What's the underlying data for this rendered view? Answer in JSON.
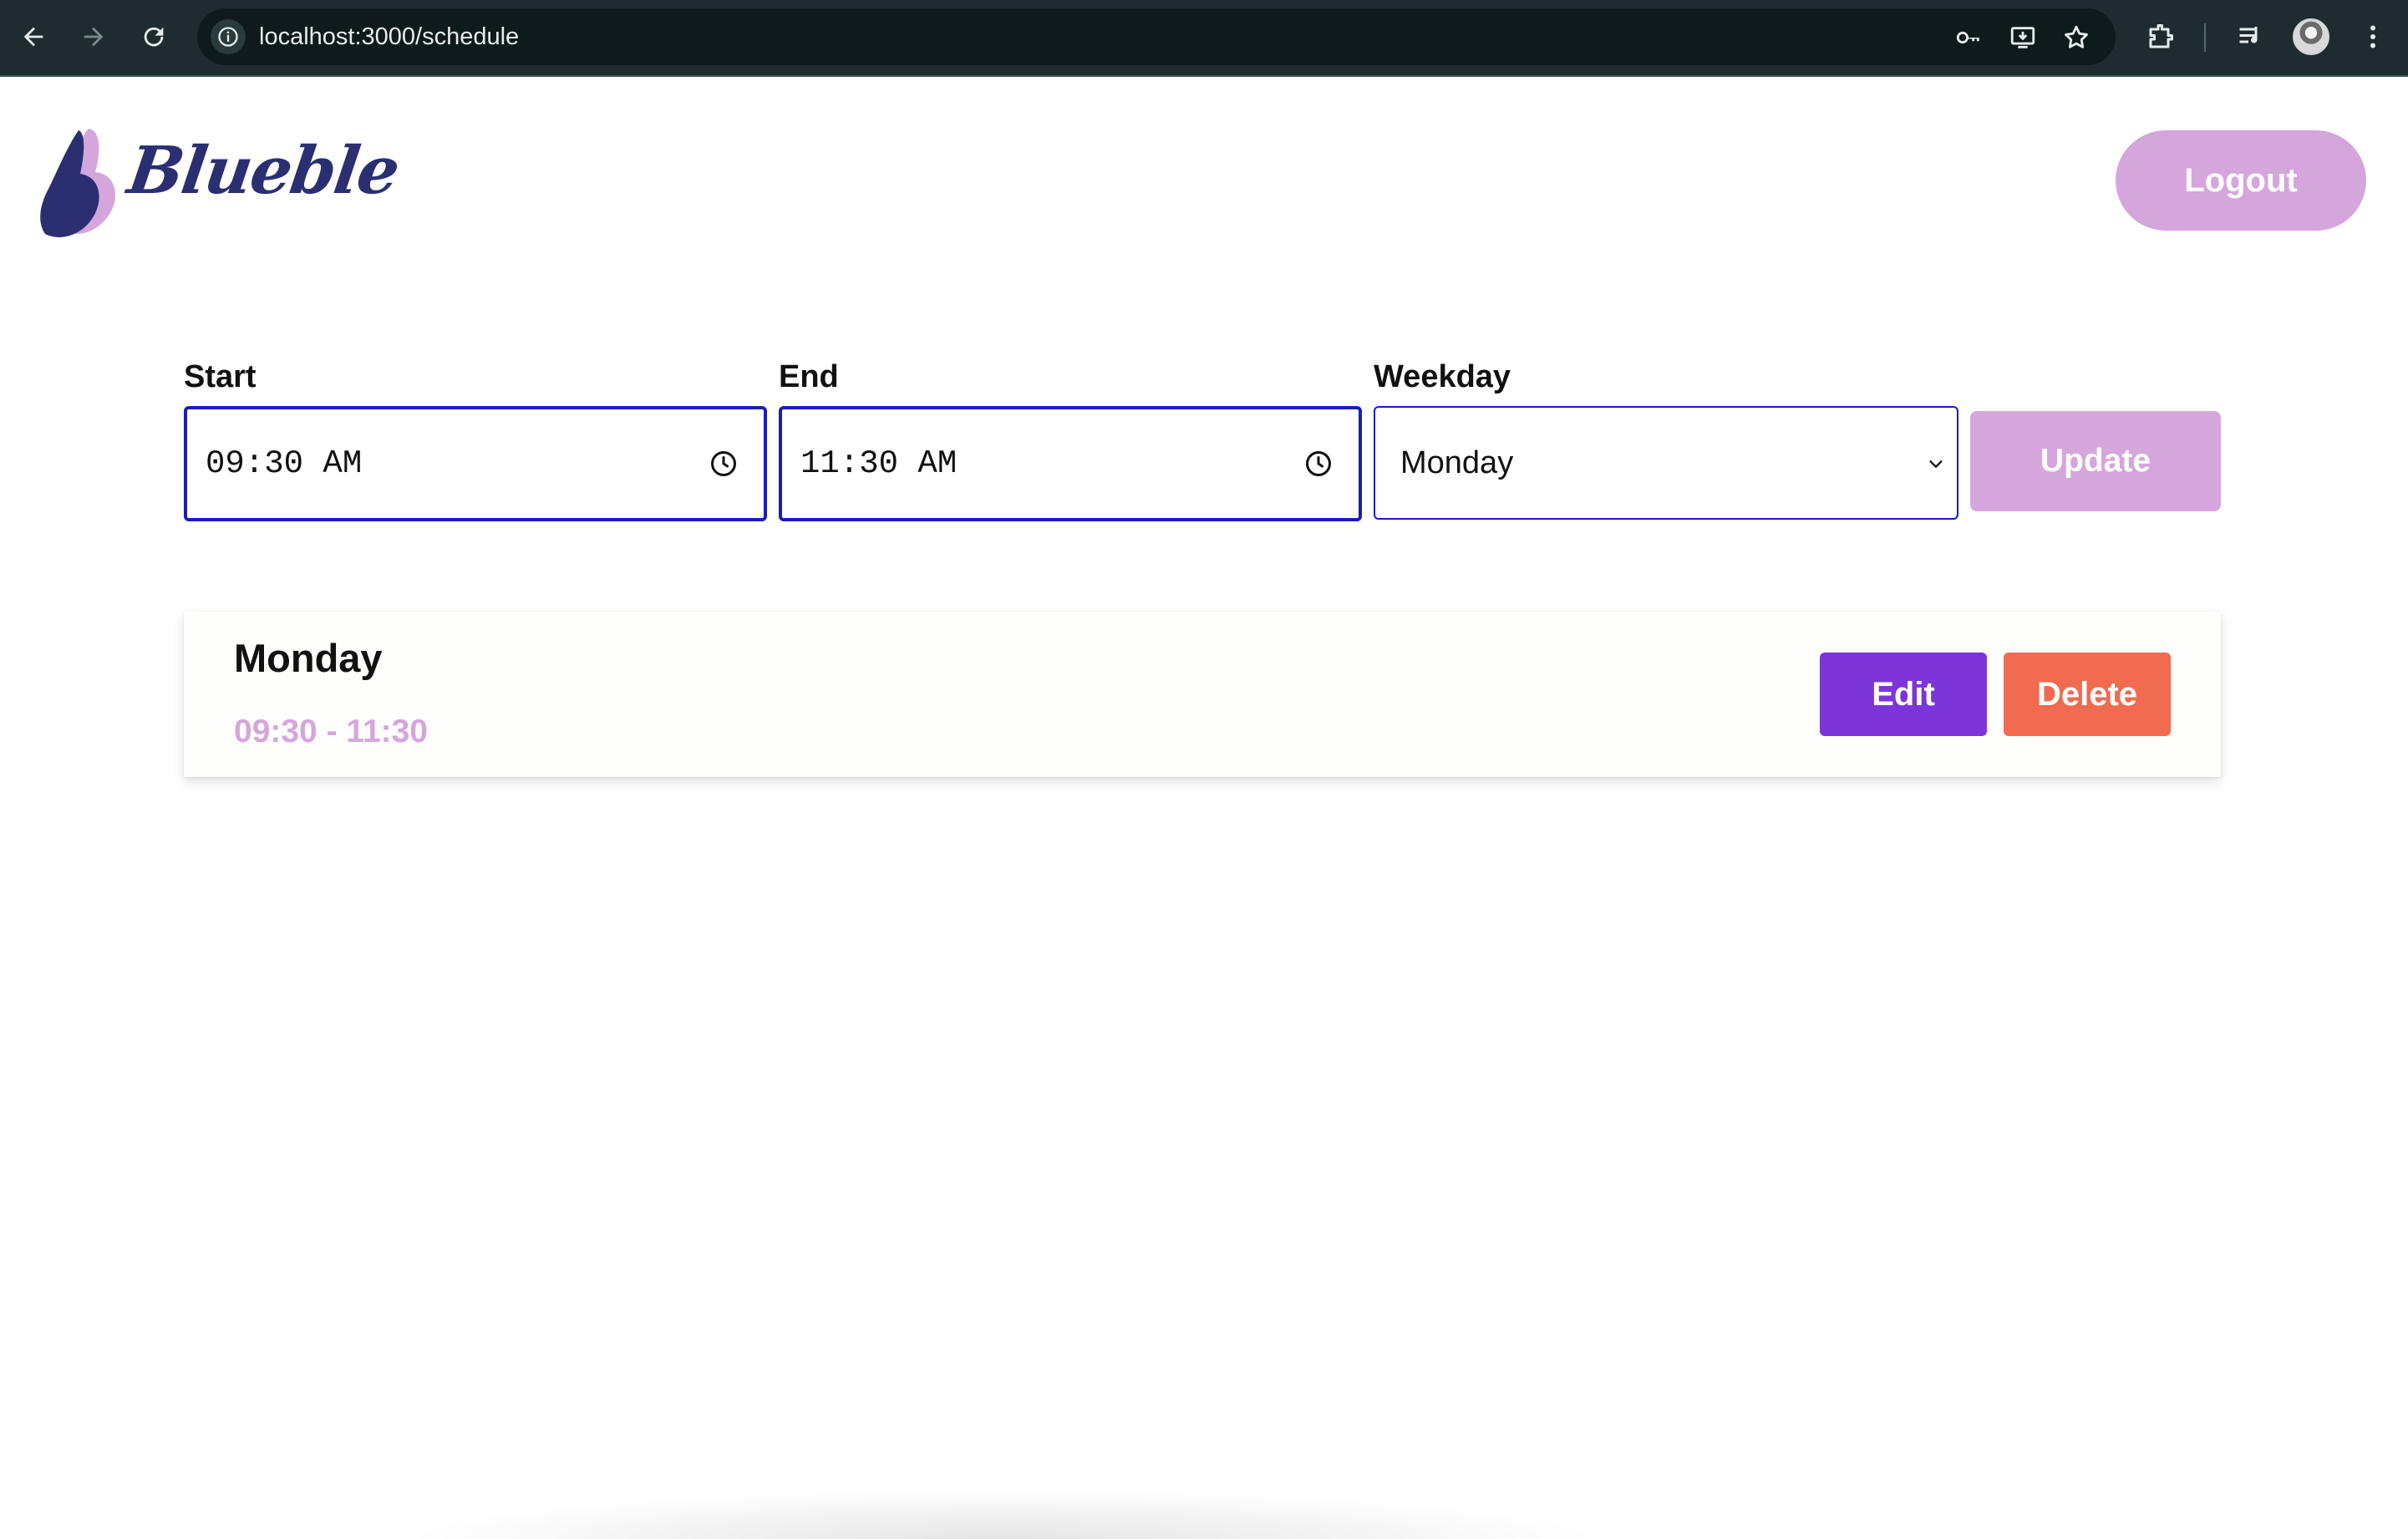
{
  "browser": {
    "url": "localhost:3000/schedule",
    "nav": {
      "back_icon": "arrow-left-icon",
      "forward_icon": "arrow-right-icon",
      "reload_icon": "reload-icon"
    },
    "toolbar_icons": [
      "password-key-icon",
      "install-app-icon",
      "bookmark-star-icon",
      "extensions-icon",
      "reading-list-icon",
      "profile-avatar",
      "more-menu-icon"
    ]
  },
  "header": {
    "logo_text": "Blueble",
    "logout_label": "Logout"
  },
  "form": {
    "start_label": "Start",
    "start_value": "09:30 AM",
    "end_label": "End",
    "end_value": "11:30 AM",
    "weekday_label": "Weekday",
    "weekday_value": "Monday",
    "update_label": "Update"
  },
  "schedules": [
    {
      "day": "Monday",
      "time_range": "09:30 - 11:30",
      "edit_label": "Edit",
      "delete_label": "Delete"
    }
  ],
  "colors": {
    "accent_pink": "#d5a6dc",
    "edit_purple": "#7b35d9",
    "delete_orange": "#f06b4f",
    "logo_navy": "#2b2f72",
    "input_border": "#1c1cb8",
    "chrome_bg": "#1f2b2e"
  }
}
